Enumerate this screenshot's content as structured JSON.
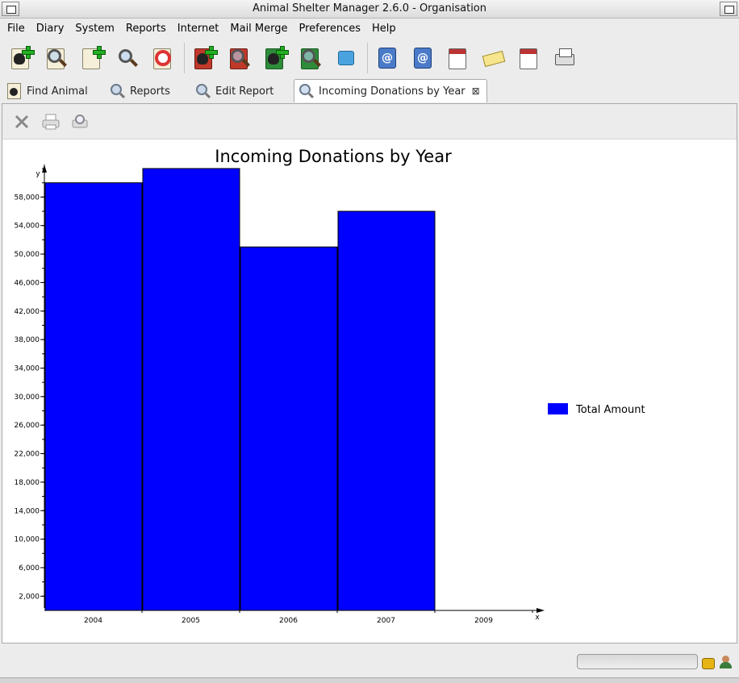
{
  "window": {
    "title": "Animal Shelter Manager 2.6.0 - Organisation"
  },
  "menu": [
    "File",
    "Diary",
    "System",
    "Reports",
    "Internet",
    "Mail Merge",
    "Preferences",
    "Help"
  ],
  "toolbar_icons": [
    "add-animal-icon",
    "find-animal-icon",
    "add-owner-icon",
    "find-owner-icon",
    "lost-found-icon",
    "add-lost-animal-icon",
    "find-lost-animal-icon",
    "add-found-animal-icon",
    "find-found-animal-icon",
    "match-icon",
    "mail-merge-icon",
    "address-book-icon",
    "diary-icon",
    "messages-icon",
    "calendar-task-icon",
    "print-icon"
  ],
  "tabs": [
    {
      "label": "Find Animal",
      "icon": "find-animal-icon"
    },
    {
      "label": "Reports",
      "icon": "reports-icon"
    },
    {
      "label": "Edit Report",
      "icon": "edit-report-icon"
    },
    {
      "label": "Incoming Donations by Year",
      "icon": "report-icon",
      "active": true,
      "close": "⊠"
    }
  ],
  "panel_toolbar": [
    "close-icon",
    "print-icon",
    "print-preview-icon"
  ],
  "chart_data": {
    "type": "bar",
    "title": "Incoming Donations by Year",
    "xlabel": "x",
    "ylabel": "y",
    "categories": [
      "2004",
      "2005",
      "2006",
      "2007",
      "2009"
    ],
    "series": [
      {
        "name": "Total Amount",
        "values": [
          60000,
          62000,
          51000,
          56000,
          null
        ]
      }
    ],
    "ylim": [
      0,
      62000
    ],
    "yticks": [
      2000,
      6000,
      10000,
      14000,
      18000,
      22000,
      26000,
      30000,
      34000,
      38000,
      42000,
      46000,
      50000,
      54000,
      58000
    ],
    "yminor_step": 2000,
    "grid": false,
    "legend": "right",
    "colors": {
      "bar": "#0000ff",
      "bar_outline": "#000000",
      "axis": "#000000"
    }
  },
  "status": {
    "progress": 0
  }
}
